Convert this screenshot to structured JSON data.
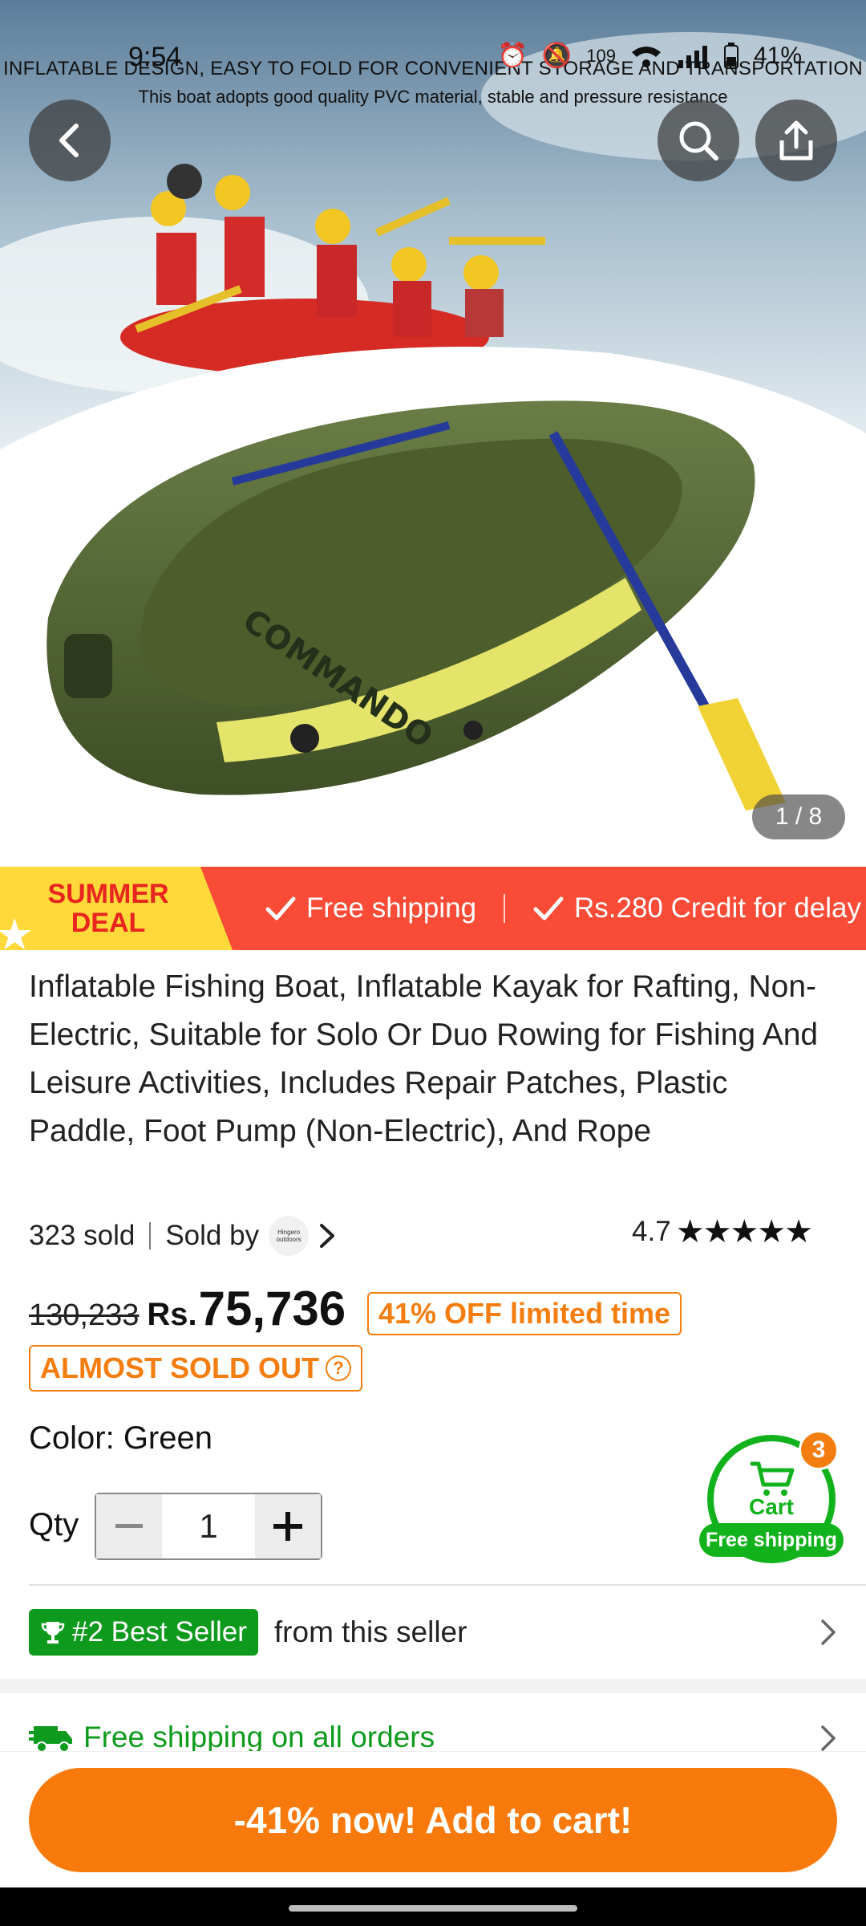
{
  "status_bar": {
    "time": "9:54",
    "battery": "41%",
    "net_speed": "109"
  },
  "hero": {
    "banner_line1": "INFLATABLE DESIGN, EASY TO FOLD FOR CONVENIENT STORAGE AND TRANSPORTATION",
    "banner_line2": "This boat adopts good quality PVC material, stable and pressure resistance",
    "boat_text": "COMMANDO",
    "image_counter": "1 / 8"
  },
  "promo": {
    "deal_line1": "SUMMER",
    "deal_line2": "DEAL",
    "item1": "Free shipping",
    "item2": "Rs.280 Credit for delay"
  },
  "product": {
    "title": "Inflatable Fishing Boat, Inflatable Kayak for Rafting, Non-Electric, Suitable for Solo Or Duo Rowing for Fishing And Leisure Activities, Includes Repair Patches, Plastic Paddle, Foot Pump (Non-Electric), And Rope",
    "sold": "323 sold",
    "sold_by": "Sold by",
    "seller_logo_text": "Hingero outdoors",
    "rating": "4.7",
    "old_price": "130,233",
    "currency": "Rs.",
    "price": "75,736",
    "discount_badge": "41% OFF limited time",
    "stock_badge": "ALMOST SOLD OUT",
    "color_label": "Color: Green",
    "qty_label": "Qty",
    "qty_value": "1"
  },
  "cart_widget": {
    "label": "Cart",
    "shipping": "Free shipping",
    "count": "3"
  },
  "best_seller": {
    "badge": "#2 Best Seller",
    "text": "from this seller"
  },
  "shipping_row": {
    "text": "Free shipping on all orders"
  },
  "cta": {
    "label": "-41% now! Add to cart!"
  },
  "colors": {
    "accent_orange": "#f97a0c",
    "promo_red": "#fa4b36",
    "deal_yellow": "#ffd83a",
    "green": "#0e9a1d"
  }
}
